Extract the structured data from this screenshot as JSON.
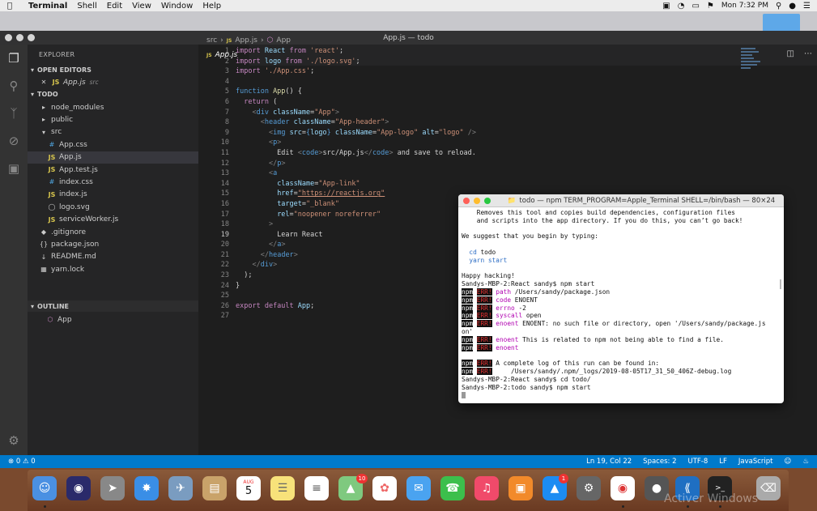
{
  "menubar": {
    "app": "Terminal",
    "items": [
      "Shell",
      "Edit",
      "View",
      "Window",
      "Help"
    ],
    "clock": "Mon 7:32 PM"
  },
  "vscode": {
    "window_title": "App.js — todo",
    "sidebar": {
      "title": "EXPLORER",
      "open_editors_label": "OPEN EDITORS",
      "open_editor": {
        "name": "App.js",
        "path": "src"
      },
      "project_label": "TODO",
      "tree": [
        {
          "label": "node_modules",
          "kind": "folder",
          "indent": 1
        },
        {
          "label": "public",
          "kind": "folder",
          "indent": 1
        },
        {
          "label": "src",
          "kind": "folder-open",
          "indent": 1
        },
        {
          "label": "App.css",
          "kind": "css",
          "indent": 2
        },
        {
          "label": "App.js",
          "kind": "js",
          "indent": 2
        },
        {
          "label": "App.test.js",
          "kind": "js",
          "indent": 2
        },
        {
          "label": "index.css",
          "kind": "css",
          "indent": 2
        },
        {
          "label": "index.js",
          "kind": "js",
          "indent": 2
        },
        {
          "label": "logo.svg",
          "kind": "svg",
          "indent": 2
        },
        {
          "label": "serviceWorker.js",
          "kind": "js",
          "indent": 2
        },
        {
          "label": ".gitignore",
          "kind": "git",
          "indent": 1
        },
        {
          "label": "package.json",
          "kind": "json",
          "indent": 1
        },
        {
          "label": "README.md",
          "kind": "md",
          "indent": 1
        },
        {
          "label": "yarn.lock",
          "kind": "lock",
          "indent": 1
        }
      ],
      "outline_label": "OUTLINE",
      "outline_item": "App"
    },
    "tab": {
      "label": "App.js",
      "icon": "JS"
    },
    "breadcrumb": {
      "folder": "src",
      "file": "App.js",
      "symbol": "App"
    },
    "current_line": 19,
    "status": {
      "problems": "0",
      "warnings": "0",
      "position": "Ln 19, Col 22",
      "spaces": "Spaces: 2",
      "encoding": "UTF-8",
      "eol": "LF",
      "language": "JavaScript"
    }
  },
  "code_lines": [
    [
      [
        "k",
        "import "
      ],
      [
        "v",
        "React "
      ],
      [
        "k",
        "from "
      ],
      [
        "s",
        "'react'"
      ],
      [
        "p",
        ";"
      ]
    ],
    [
      [
        "k",
        "import "
      ],
      [
        "v",
        "logo "
      ],
      [
        "k",
        "from "
      ],
      [
        "s",
        "'./logo.svg'"
      ],
      [
        "p",
        ";"
      ]
    ],
    [
      [
        "k",
        "import "
      ],
      [
        "s",
        "'./App.css'"
      ],
      [
        "p",
        ";"
      ]
    ],
    [],
    [
      [
        "t",
        "function "
      ],
      [
        "f",
        "App"
      ],
      [
        "p",
        "() {"
      ]
    ],
    [
      [
        "p",
        "  "
      ],
      [
        "k",
        "return "
      ],
      [
        "p",
        "("
      ]
    ],
    [
      [
        "p",
        "    "
      ],
      [
        "g",
        "<"
      ],
      [
        "t",
        "div "
      ],
      [
        "a",
        "className"
      ],
      [
        "p",
        "="
      ],
      [
        "s",
        "\"App\""
      ],
      [
        "g",
        ">"
      ]
    ],
    [
      [
        "p",
        "      "
      ],
      [
        "g",
        "<"
      ],
      [
        "t",
        "header "
      ],
      [
        "a",
        "className"
      ],
      [
        "p",
        "="
      ],
      [
        "s",
        "\"App-header\""
      ],
      [
        "g",
        ">"
      ]
    ],
    [
      [
        "p",
        "        "
      ],
      [
        "g",
        "<"
      ],
      [
        "t",
        "img "
      ],
      [
        "a",
        "src"
      ],
      [
        "p",
        "="
      ],
      [
        "t",
        "{"
      ],
      [
        "v",
        "logo"
      ],
      [
        "t",
        "} "
      ],
      [
        "a",
        "className"
      ],
      [
        "p",
        "="
      ],
      [
        "s",
        "\"App-logo\" "
      ],
      [
        "a",
        "alt"
      ],
      [
        "p",
        "="
      ],
      [
        "s",
        "\"logo\" "
      ],
      [
        "g",
        "/>"
      ]
    ],
    [
      [
        "p",
        "        "
      ],
      [
        "g",
        "<"
      ],
      [
        "t",
        "p"
      ],
      [
        "g",
        ">"
      ]
    ],
    [
      [
        "p",
        "          Edit "
      ],
      [
        "g",
        "<"
      ],
      [
        "t",
        "code"
      ],
      [
        "g",
        ">"
      ],
      [
        "p",
        "src/App.js"
      ],
      [
        "g",
        "</"
      ],
      [
        "t",
        "code"
      ],
      [
        "g",
        ">"
      ],
      [
        "p",
        " and save to reload."
      ]
    ],
    [
      [
        "p",
        "        "
      ],
      [
        "g",
        "</"
      ],
      [
        "t",
        "p"
      ],
      [
        "g",
        ">"
      ]
    ],
    [
      [
        "p",
        "        "
      ],
      [
        "g",
        "<"
      ],
      [
        "t",
        "a"
      ]
    ],
    [
      [
        "p",
        "          "
      ],
      [
        "a",
        "className"
      ],
      [
        "p",
        "="
      ],
      [
        "s",
        "\"App-link\""
      ]
    ],
    [
      [
        "p",
        "          "
      ],
      [
        "a",
        "href"
      ],
      [
        "p",
        "="
      ],
      [
        "u",
        "\"https://reactjs.org\""
      ]
    ],
    [
      [
        "p",
        "          "
      ],
      [
        "a",
        "target"
      ],
      [
        "p",
        "="
      ],
      [
        "s",
        "\"_blank\""
      ]
    ],
    [
      [
        "p",
        "          "
      ],
      [
        "a",
        "rel"
      ],
      [
        "p",
        "="
      ],
      [
        "s",
        "\"noopener noreferrer\""
      ]
    ],
    [
      [
        "p",
        "        "
      ],
      [
        "g",
        ">"
      ]
    ],
    [
      [
        "p",
        "          Learn React"
      ]
    ],
    [
      [
        "p",
        "        "
      ],
      [
        "g",
        "</"
      ],
      [
        "t",
        "a"
      ],
      [
        "g",
        ">"
      ]
    ],
    [
      [
        "p",
        "      "
      ],
      [
        "g",
        "</"
      ],
      [
        "t",
        "header"
      ],
      [
        "g",
        ">"
      ]
    ],
    [
      [
        "p",
        "    "
      ],
      [
        "g",
        "</"
      ],
      [
        "t",
        "div"
      ],
      [
        "g",
        ">"
      ]
    ],
    [
      [
        "p",
        "  );"
      ]
    ],
    [
      [
        "p",
        "}"
      ]
    ],
    [],
    [
      [
        "k",
        "export "
      ],
      [
        "k",
        "default "
      ],
      [
        "v",
        "App"
      ],
      [
        "p",
        ";"
      ]
    ],
    []
  ],
  "terminal": {
    "title": "todo — npm TERM_PROGRAM=Apple_Terminal SHELL=/bin/bash — 80×24",
    "lines": [
      [
        [
          "p",
          "    Removes this tool and copies build dependencies, configuration files"
        ]
      ],
      [
        [
          "p",
          "    and scripts into the app directory. If you do this, you can’t go back!"
        ]
      ],
      [],
      [
        [
          "p",
          "We suggest that you begin by typing:"
        ]
      ],
      [],
      [
        [
          "p",
          "  "
        ],
        [
          "b",
          "cd"
        ],
        [
          "p",
          " todo"
        ]
      ],
      [
        [
          "p",
          "  "
        ],
        [
          "b",
          "yarn start"
        ]
      ],
      [],
      [
        [
          "p",
          "Happy hacking!"
        ]
      ],
      [
        [
          "p",
          "Sandys-MBP-2:React sandy$ npm start"
        ]
      ],
      [
        [
          "n",
          "npm"
        ],
        [
          "p",
          " "
        ],
        [
          "e",
          "ERR!"
        ],
        [
          "p",
          " "
        ],
        [
          "m",
          "path"
        ],
        [
          "p",
          " /Users/sandy/package.json"
        ]
      ],
      [
        [
          "n",
          "npm"
        ],
        [
          "p",
          " "
        ],
        [
          "e",
          "ERR!"
        ],
        [
          "p",
          " "
        ],
        [
          "m",
          "code"
        ],
        [
          "p",
          " ENOENT"
        ]
      ],
      [
        [
          "n",
          "npm"
        ],
        [
          "p",
          " "
        ],
        [
          "e",
          "ERR!"
        ],
        [
          "p",
          " "
        ],
        [
          "m",
          "errno"
        ],
        [
          "p",
          " -2"
        ]
      ],
      [
        [
          "n",
          "npm"
        ],
        [
          "p",
          " "
        ],
        [
          "e",
          "ERR!"
        ],
        [
          "p",
          " "
        ],
        [
          "m",
          "syscall"
        ],
        [
          "p",
          " open"
        ]
      ],
      [
        [
          "n",
          "npm"
        ],
        [
          "p",
          " "
        ],
        [
          "e",
          "ERR!"
        ],
        [
          "p",
          " "
        ],
        [
          "m",
          "enoent"
        ],
        [
          "p",
          " ENOENT: no such file or directory, open '/Users/sandy/package.js"
        ]
      ],
      [
        [
          "p",
          "on'"
        ]
      ],
      [
        [
          "n",
          "npm"
        ],
        [
          "p",
          " "
        ],
        [
          "e",
          "ERR!"
        ],
        [
          "p",
          " "
        ],
        [
          "m",
          "enoent"
        ],
        [
          "p",
          " This is related to npm not being able to find a file."
        ]
      ],
      [
        [
          "n",
          "npm"
        ],
        [
          "p",
          " "
        ],
        [
          "e",
          "ERR!"
        ],
        [
          "p",
          " "
        ],
        [
          "m",
          "enoent"
        ]
      ],
      [],
      [
        [
          "n",
          "npm"
        ],
        [
          "p",
          " "
        ],
        [
          "e",
          "ERR!"
        ],
        [
          "p",
          " A complete log of this run can be found in:"
        ]
      ],
      [
        [
          "n",
          "npm"
        ],
        [
          "p",
          " "
        ],
        [
          "e",
          "ERR!"
        ],
        [
          "p",
          "     /Users/sandy/.npm/_logs/2019-08-05T17_31_50_406Z-debug.log"
        ]
      ],
      [
        [
          "p",
          "Sandys-MBP-2:React sandy$ cd todo/"
        ]
      ],
      [
        [
          "p",
          "Sandys-MBP-2:todo sandy$ npm start"
        ]
      ],
      [
        [
          "c",
          ""
        ]
      ]
    ]
  },
  "dock": {
    "calendar_month": "AUG",
    "calendar_day": "5",
    "appstore_badge": "1",
    "maps_badge": "10",
    "watermark": "Activer Windows"
  },
  "colors": {
    "statusbar": "#007acc",
    "activity": "#333333",
    "sidebar": "#252526",
    "editor": "#1e1e1e"
  }
}
